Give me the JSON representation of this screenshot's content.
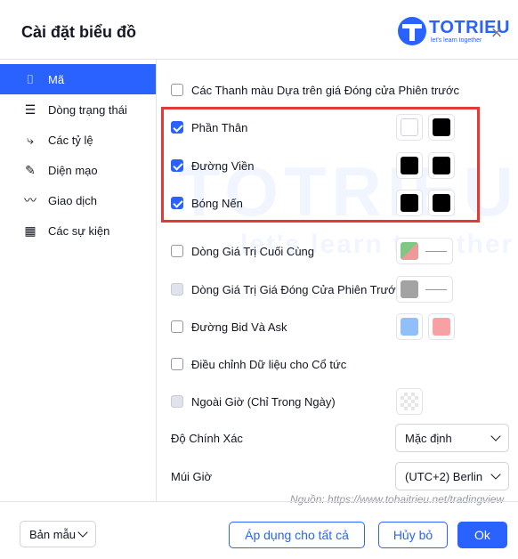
{
  "dialog": {
    "title": "Cài đặt biểu đồ",
    "logo_text": "TOTRIEU",
    "logo_sub": "let's learn together",
    "close_label": "×"
  },
  "sidebar": {
    "items": [
      {
        "label": "Mã",
        "icon": "candles-icon",
        "glyph": "⌷",
        "active": true
      },
      {
        "label": "Dòng trạng thái",
        "icon": "status-line-icon",
        "glyph": "☰",
        "active": false
      },
      {
        "label": "Các tỷ lệ",
        "icon": "scales-icon",
        "glyph": "⤷",
        "active": false
      },
      {
        "label": "Diện mạo",
        "icon": "pencil-icon",
        "glyph": "✎",
        "active": false
      },
      {
        "label": "Giao dịch",
        "icon": "trading-icon",
        "glyph": "〰",
        "active": false
      },
      {
        "label": "Các sự kiện",
        "icon": "calendar-icon",
        "glyph": "▦",
        "active": false
      }
    ]
  },
  "settings": {
    "bars_color": {
      "label": "Các Thanh màu Dựa trên giá Đóng cửa Phiên trước",
      "checked": false
    },
    "body": {
      "label": "Phần Thân",
      "checked": true,
      "color1": "#ffffff",
      "color2": "#000000"
    },
    "borders": {
      "label": "Đường Viền",
      "checked": true,
      "color1": "#000000",
      "color2": "#000000"
    },
    "wick": {
      "label": "Bóng Nến",
      "checked": true,
      "color1": "#000000",
      "color2": "#000000"
    },
    "last_value": {
      "label": "Dòng Giá Trị Cuối Cùng",
      "checked": false,
      "color": "#ef9a9a"
    },
    "prev_close": {
      "label": "Dòng Giá Trị Giá Đóng Cửa Phiên Trước",
      "checked": false,
      "disabled": true,
      "color": "#a3a3a3"
    },
    "bid_ask": {
      "label": "Đường Bid Và Ask",
      "checked": false,
      "color1": "#90bff9",
      "color2": "#f7a1a5"
    },
    "dividends": {
      "label": "Điều chỉnh Dữ liệu cho Cổ tức",
      "checked": false
    },
    "extended_hours": {
      "label": "Ngoài Giờ (Chỉ Trong Ngày)",
      "checked": false,
      "disabled": true
    },
    "precision": {
      "label": "Độ Chính Xác",
      "value": "Mặc định"
    },
    "timezone": {
      "label": "Múi Giờ",
      "value": "(UTC+2) Berlin"
    }
  },
  "source_note": "Nguồn: https://www.tohaitrieu.net/tradingview",
  "footer": {
    "template_label": "Bản mẫu",
    "apply_all_label": "Áp dụng cho tất cả",
    "cancel_label": "Hủy bỏ",
    "ok_label": "Ok"
  },
  "watermark": {
    "big": "TOTRIEU",
    "small": "let's learn together"
  },
  "colors": {
    "accent": "#2962ff",
    "highlight": "#e53935"
  }
}
